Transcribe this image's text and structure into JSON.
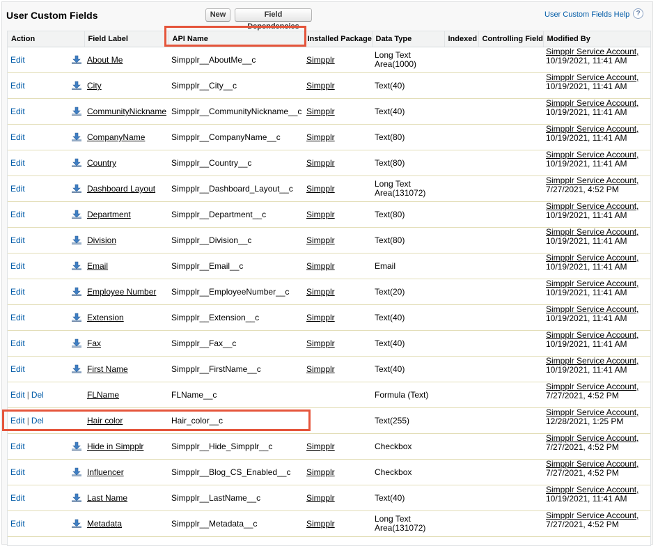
{
  "header": {
    "title": "User Custom Fields",
    "new_button": "New",
    "dependencies_button": "Field Dependencies",
    "help_link": "User Custom Fields Help",
    "help_icon_glyph": "?"
  },
  "columns": {
    "action": "Action",
    "field_label": "Field Label",
    "api_name": "API Name",
    "installed_package": "Installed Package",
    "data_type": "Data Type",
    "indexed": "Indexed",
    "controlling_field": "Controlling Field",
    "modified_by": "Modified By"
  },
  "actions": {
    "edit": "Edit",
    "del": "Del",
    "separator": "|"
  },
  "rows": [
    {
      "label": "About Me",
      "api": "Simpplr__AboutMe__c",
      "package": "Simpplr",
      "type": "Long Text Area(1000)",
      "indexed": "",
      "controlling": "",
      "modified_name": "Simpplr Service Account,",
      "modified_date": "10/19/2021, 11:41 AM",
      "deletable": false,
      "managed": true
    },
    {
      "label": "City",
      "api": "Simpplr__City__c",
      "package": "Simpplr",
      "type": "Text(40)",
      "indexed": "",
      "controlling": "",
      "modified_name": "Simpplr Service Account,",
      "modified_date": "10/19/2021, 11:41 AM",
      "deletable": false,
      "managed": true
    },
    {
      "label": "CommunityNickname",
      "api": "Simpplr__CommunityNickname__c",
      "package": "Simpplr",
      "type": "Text(40)",
      "indexed": "",
      "controlling": "",
      "modified_name": "Simpplr Service Account,",
      "modified_date": "10/19/2021, 11:41 AM",
      "deletable": false,
      "managed": true
    },
    {
      "label": "CompanyName",
      "api": "Simpplr__CompanyName__c",
      "package": "Simpplr",
      "type": "Text(80)",
      "indexed": "",
      "controlling": "",
      "modified_name": "Simpplr Service Account,",
      "modified_date": "10/19/2021, 11:41 AM",
      "deletable": false,
      "managed": true
    },
    {
      "label": "Country",
      "api": "Simpplr__Country__c",
      "package": "Simpplr",
      "type": "Text(80)",
      "indexed": "",
      "controlling": "",
      "modified_name": "Simpplr Service Account,",
      "modified_date": "10/19/2021, 11:41 AM",
      "deletable": false,
      "managed": true
    },
    {
      "label": "Dashboard Layout",
      "api": "Simpplr__Dashboard_Layout__c",
      "package": "Simpplr",
      "type": "Long Text Area(131072)",
      "indexed": "",
      "controlling": "",
      "modified_name": "Simpplr Service Account,",
      "modified_date": "7/27/2021, 4:52 PM",
      "deletable": false,
      "managed": true
    },
    {
      "label": "Department",
      "api": "Simpplr__Department__c",
      "package": "Simpplr",
      "type": "Text(80)",
      "indexed": "",
      "controlling": "",
      "modified_name": "Simpplr Service Account,",
      "modified_date": "10/19/2021, 11:41 AM",
      "deletable": false,
      "managed": true
    },
    {
      "label": "Division",
      "api": "Simpplr__Division__c",
      "package": "Simpplr",
      "type": "Text(80)",
      "indexed": "",
      "controlling": "",
      "modified_name": "Simpplr Service Account,",
      "modified_date": "10/19/2021, 11:41 AM",
      "deletable": false,
      "managed": true
    },
    {
      "label": "Email",
      "api": "Simpplr__Email__c",
      "package": "Simpplr",
      "type": "Email",
      "indexed": "",
      "controlling": "",
      "modified_name": "Simpplr Service Account,",
      "modified_date": "10/19/2021, 11:41 AM",
      "deletable": false,
      "managed": true
    },
    {
      "label": "Employee Number",
      "api": "Simpplr__EmployeeNumber__c",
      "package": "Simpplr",
      "type": "Text(20)",
      "indexed": "",
      "controlling": "",
      "modified_name": "Simpplr Service Account,",
      "modified_date": "10/19/2021, 11:41 AM",
      "deletable": false,
      "managed": true
    },
    {
      "label": "Extension",
      "api": "Simpplr__Extension__c",
      "package": "Simpplr",
      "type": "Text(40)",
      "indexed": "",
      "controlling": "",
      "modified_name": "Simpplr Service Account,",
      "modified_date": "10/19/2021, 11:41 AM",
      "deletable": false,
      "managed": true
    },
    {
      "label": "Fax",
      "api": "Simpplr__Fax__c",
      "package": "Simpplr",
      "type": "Text(40)",
      "indexed": "",
      "controlling": "",
      "modified_name": "Simpplr Service Account,",
      "modified_date": "10/19/2021, 11:41 AM",
      "deletable": false,
      "managed": true
    },
    {
      "label": "First Name",
      "api": "Simpplr__FirstName__c",
      "package": "Simpplr",
      "type": "Text(40)",
      "indexed": "",
      "controlling": "",
      "modified_name": "Simpplr Service Account,",
      "modified_date": "10/19/2021, 11:41 AM",
      "deletable": false,
      "managed": true
    },
    {
      "label": "FLName",
      "api": "FLName__c",
      "package": "",
      "type": "Formula (Text)",
      "indexed": "",
      "controlling": "",
      "modified_name": "Simpplr Service Account,",
      "modified_date": "7/27/2021, 4:52 PM",
      "deletable": true,
      "managed": false
    },
    {
      "label": "Hair color",
      "api": "Hair_color__c",
      "package": "",
      "type": "Text(255)",
      "indexed": "",
      "controlling": "",
      "modified_name": "Simpplr Service Account,",
      "modified_date": "12/28/2021, 1:25 PM",
      "deletable": true,
      "managed": false
    },
    {
      "label": "Hide in Simpplr",
      "api": "Simpplr__Hide_Simpplr__c",
      "package": "Simpplr",
      "type": "Checkbox",
      "indexed": "",
      "controlling": "",
      "modified_name": "Simpplr Service Account,",
      "modified_date": "7/27/2021, 4:52 PM",
      "deletable": false,
      "managed": true
    },
    {
      "label": "Influencer",
      "api": "Simpplr__Blog_CS_Enabled__c",
      "package": "Simpplr",
      "type": "Checkbox",
      "indexed": "",
      "controlling": "",
      "modified_name": "Simpplr Service Account,",
      "modified_date": "7/27/2021, 4:52 PM",
      "deletable": false,
      "managed": true
    },
    {
      "label": "Last Name",
      "api": "Simpplr__LastName__c",
      "package": "Simpplr",
      "type": "Text(40)",
      "indexed": "",
      "controlling": "",
      "modified_name": "Simpplr Service Account,",
      "modified_date": "10/19/2021, 11:41 AM",
      "deletable": false,
      "managed": true
    },
    {
      "label": "Metadata",
      "api": "Simpplr__Metadata__c",
      "package": "Simpplr",
      "type": "Long Text Area(131072)",
      "indexed": "",
      "controlling": "",
      "modified_name": "Simpplr Service Account,",
      "modified_date": "7/27/2021, 4:52 PM",
      "deletable": false,
      "managed": true
    }
  ],
  "colors": {
    "link_blue": "#015ba7",
    "highlight_red": "#e5553b",
    "row_border": "#e3deb8"
  },
  "icons": {
    "managed_package": "download-arrow-icon",
    "help": "help-icon"
  }
}
